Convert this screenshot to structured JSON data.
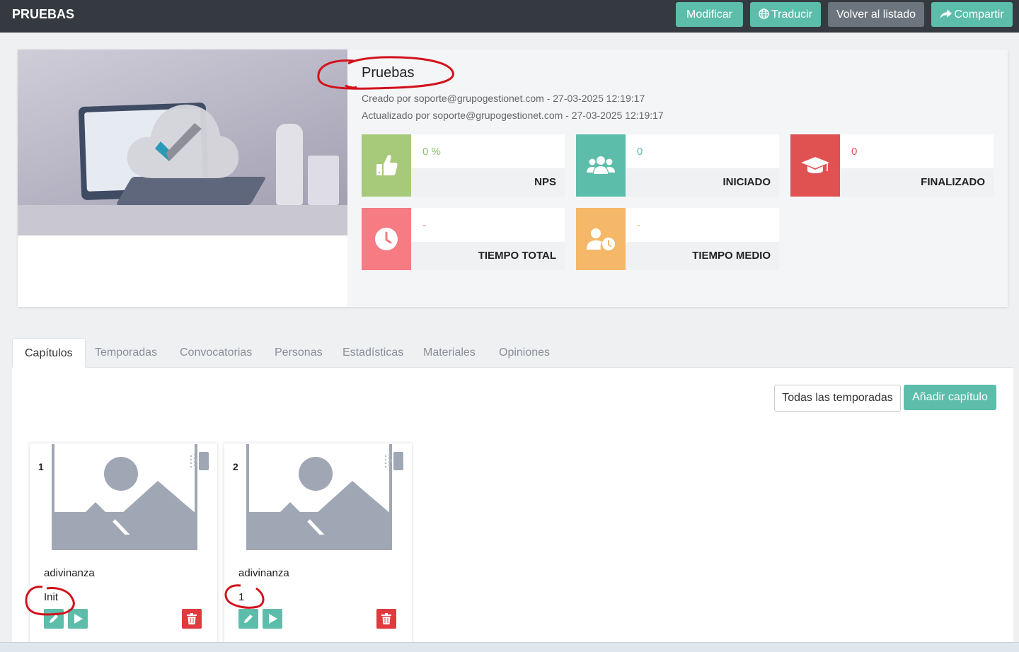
{
  "topbar": {
    "title": "PRUEBAS",
    "buttons": {
      "modify": "Modificar",
      "translate": "Traducir",
      "back": "Volver al listado",
      "share": "Compartir"
    }
  },
  "header": {
    "title": "Pruebas",
    "created": "Creado por soporte@grupogestionet.com - 27-03-2025 12:19:17",
    "updated": "Actualizado por soporte@grupogestionet.com - 27-03-2025 12:19:17"
  },
  "stats": [
    {
      "value": "0 %",
      "label": "NPS",
      "color": "#a7c97a",
      "value_color": "#8dbf6a",
      "icon": "thumbs-up-icon"
    },
    {
      "value": "0",
      "label": "INICIADO",
      "color": "#5cbdaa",
      "value_color": "#5cbdaa",
      "icon": "users-icon"
    },
    {
      "value": "0",
      "label": "FINALIZADO",
      "color": "#e05252",
      "value_color": "#e05252",
      "icon": "graduation-cap-icon"
    },
    {
      "value": "-",
      "label": "TIEMPO TOTAL",
      "color": "#f67b82",
      "value_color": "#f67b82",
      "icon": "clock-icon"
    },
    {
      "value": "-",
      "label": "TIEMPO MEDIO",
      "color": "#f5b868",
      "value_color": "#f5b868",
      "icon": "user-clock-icon"
    }
  ],
  "tabs": [
    "Capítulos",
    "Temporadas",
    "Convocatorias",
    "Personas",
    "Estadísticas",
    "Materiales",
    "Opiniones"
  ],
  "actions": {
    "all_seasons": "Todas las temporadas",
    "add_chapter": "Añadir capítulo"
  },
  "chapters": [
    {
      "number": "1",
      "name": "adivinanza",
      "tag": "Init"
    },
    {
      "number": "2",
      "name": "adivinanza",
      "tag": "1"
    }
  ],
  "colors": {
    "accent": "#5cbdaa",
    "topbar": "#343a40",
    "danger": "#e03a3e",
    "annotation": "#d2121c"
  }
}
